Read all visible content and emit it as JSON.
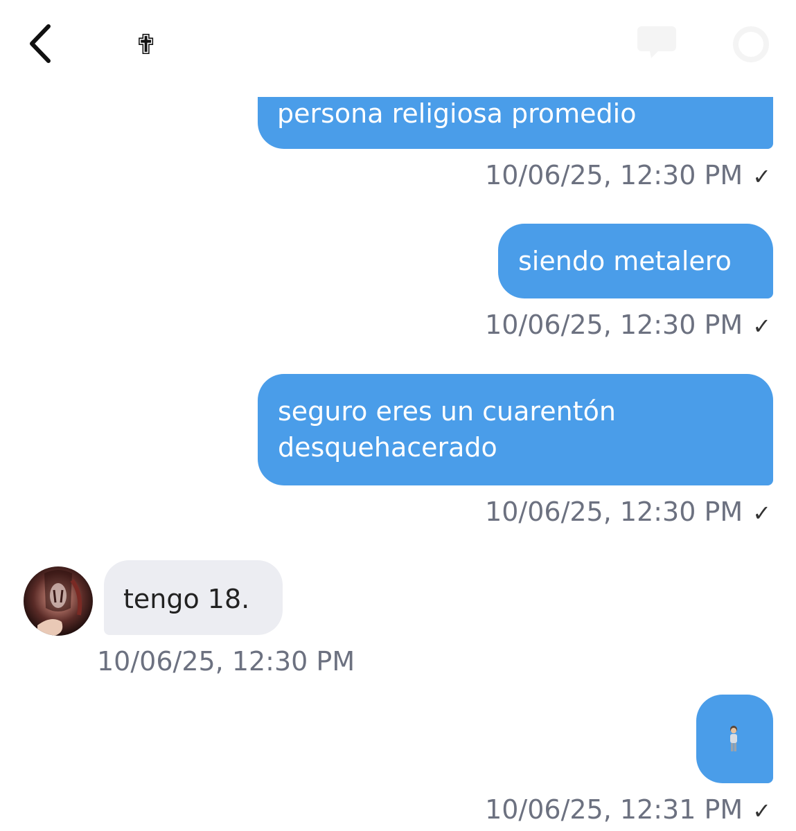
{
  "header": {
    "back_icon": "chevron-left-icon",
    "title_symbol": "✟",
    "right_icons": [
      "chat-icon",
      "settings-icon"
    ]
  },
  "messages": [
    {
      "direction": "sent",
      "text": "persona religiosa promedio",
      "timestamp": "10/06/25, 12:30 PM",
      "status": "✓"
    },
    {
      "direction": "sent",
      "text": "siendo metalero",
      "timestamp": "10/06/25, 12:30 PM",
      "status": "✓"
    },
    {
      "direction": "sent",
      "lines": [
        "seguro eres un cuarentón",
        "desquehacerado"
      ],
      "timestamp": "10/06/25, 12:30 PM",
      "status": "✓"
    },
    {
      "direction": "received",
      "text": "tengo 18.",
      "timestamp": "10/06/25, 12:30 PM"
    },
    {
      "direction": "sent",
      "emoji": "standing-person-icon",
      "timestamp": "10/06/25, 12:31 PM",
      "status": "✓"
    }
  ],
  "colors": {
    "sent_bubble": "#4a9de9",
    "received_bubble": "#ecedf2",
    "timestamp": "#6c7180"
  }
}
